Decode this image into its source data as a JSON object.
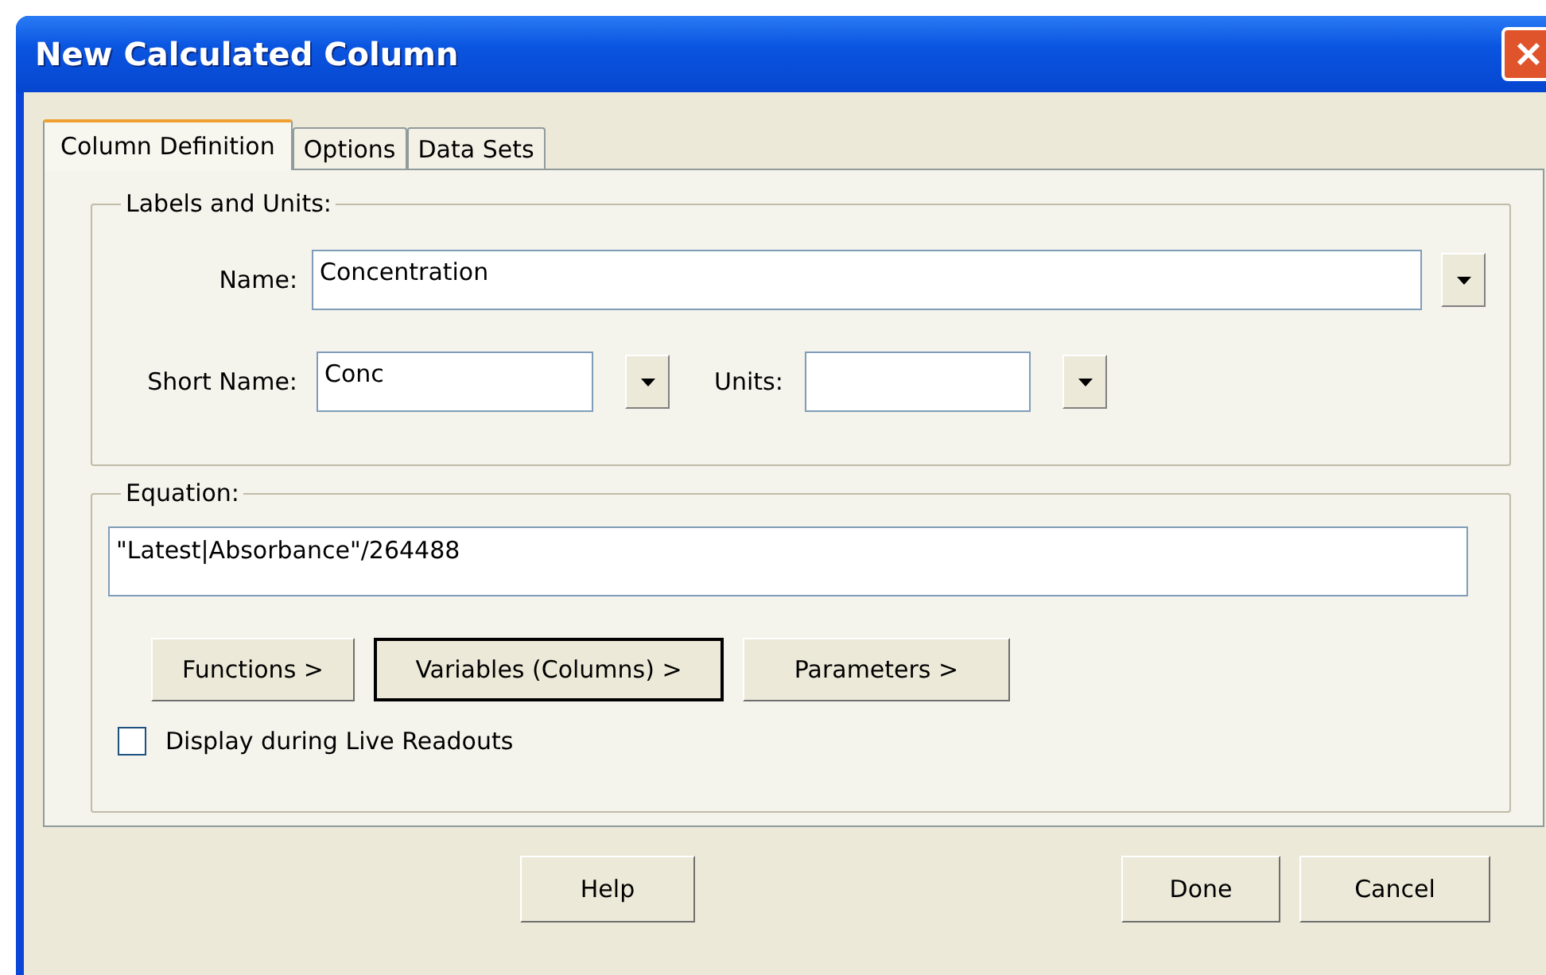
{
  "window": {
    "title": "New Calculated Column"
  },
  "tabs": [
    {
      "label": "Column Definition",
      "selected": true
    },
    {
      "label": "Options",
      "selected": false
    },
    {
      "label": "Data Sets",
      "selected": false
    }
  ],
  "labels_group": {
    "title": "Labels and Units:",
    "name_label": "Name:",
    "name_value": "Concentration",
    "short_name_label": "Short Name:",
    "short_name_value": "Conc",
    "units_label": "Units:"
  },
  "equation_group": {
    "title": "Equation:",
    "value": "\"Latest|Absorbance\"/264488",
    "buttons": [
      {
        "label": "Functions >",
        "default": false
      },
      {
        "label": "Variables (Columns) >",
        "default": true
      },
      {
        "label": "Parameters >",
        "default": false
      }
    ],
    "checkbox": {
      "label": "Display during Live Readouts",
      "checked": false
    }
  },
  "footer_buttons": [
    "Help",
    "Done",
    "Cancel"
  ]
}
